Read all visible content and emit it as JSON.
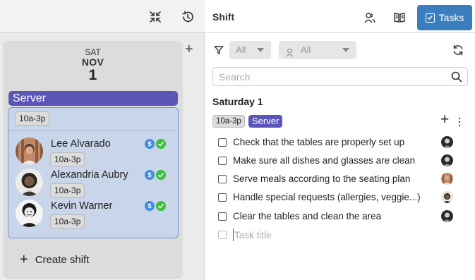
{
  "left": {
    "day": {
      "dow": "SAT",
      "month": "NOV",
      "num": "1"
    },
    "role": "Server",
    "shift": {
      "time": "10a-3p",
      "people": [
        {
          "name": "Lee Alvarado",
          "time": "10a-3p"
        },
        {
          "name": "Alexandria Aubry",
          "time": "10a-3p"
        },
        {
          "name": "Kevin Warner",
          "time": "10a-3p"
        }
      ]
    },
    "create_shift": "Create shift",
    "badge_dollar": "$"
  },
  "right": {
    "title": "Shift",
    "tasks_button": "Tasks",
    "filters": {
      "first": "All",
      "second": "All"
    },
    "search_placeholder": "Search",
    "day_title": "Saturday 1",
    "shift_time": "10a-3p",
    "role": "Server",
    "tasks": [
      "Check that the tables are properly set up",
      "Make sure all dishes and glasses are clean",
      "Serve meals according to the seating plan",
      "Handle special requests (allergies, veggie...)",
      "Clear the tables and clean the area"
    ],
    "new_task_placeholder": "Task title"
  },
  "colors": {
    "accent": "#3a7ec0",
    "role": "#5b55b8",
    "shift_bg": "#c9d5e8",
    "shift_border": "#6d98db",
    "check_badge": "#3cbf3c",
    "dollar_badge": "#3e8ee8"
  }
}
